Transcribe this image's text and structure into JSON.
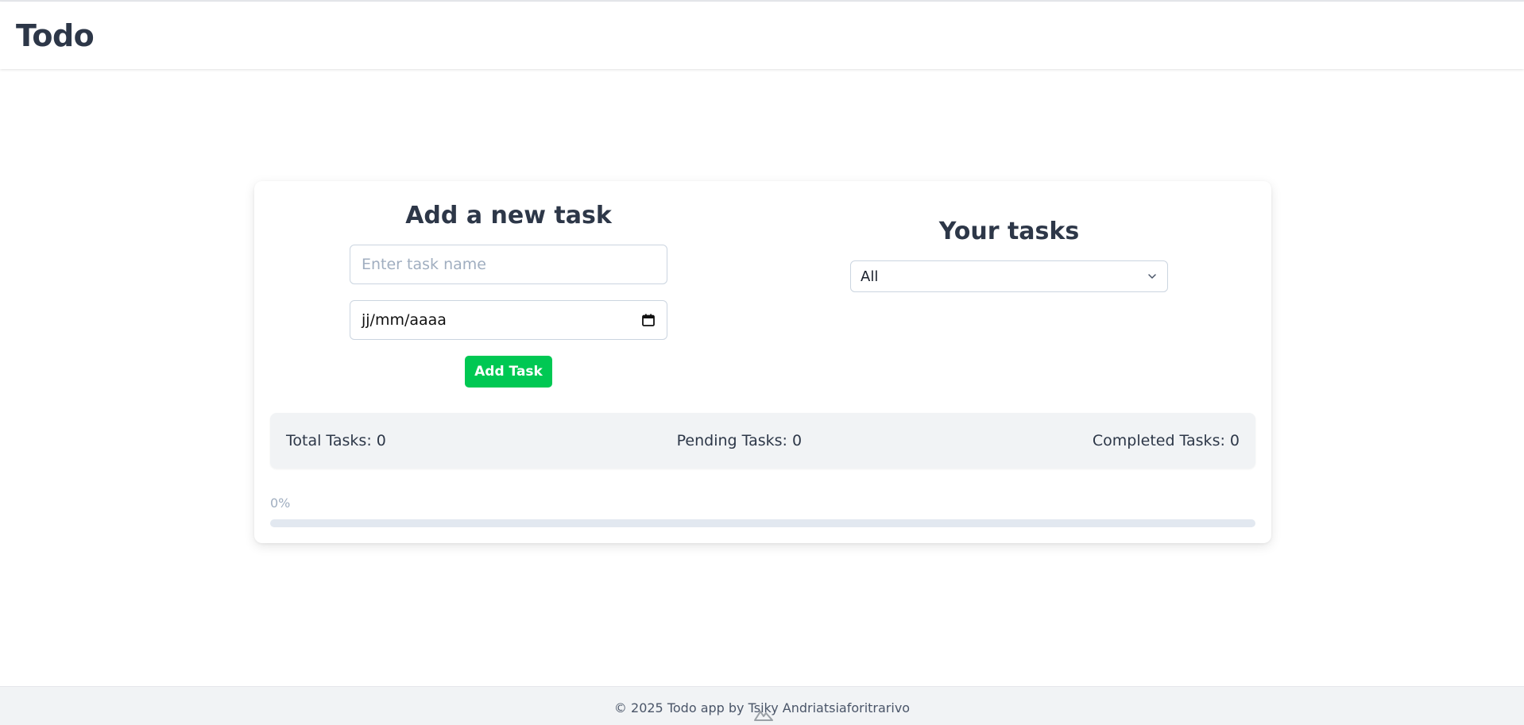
{
  "app": {
    "title": "Todo"
  },
  "add_task": {
    "heading": "Add a new task",
    "name_placeholder": "Enter task name",
    "date_placeholder": "jj/mm/aaaa",
    "button_label": "Add Task"
  },
  "tasks": {
    "heading": "Your tasks",
    "filter_selected": "All"
  },
  "stats": {
    "total_text": "Total Tasks: 0",
    "pending_text": "Pending Tasks: 0",
    "completed_text": "Completed Tasks: 0"
  },
  "progress": {
    "label": "0%",
    "percent": 0
  },
  "footer": {
    "text": "© 2025 Todo app by Tsiky Andriatsiaforitrarivo"
  },
  "colors": {
    "accent": "#00c853",
    "text": "#2d3748"
  },
  "icons": {
    "date": "calendar-icon",
    "filter": "chevron-down-icon",
    "devtools": "nuxt-devtools-icon"
  }
}
